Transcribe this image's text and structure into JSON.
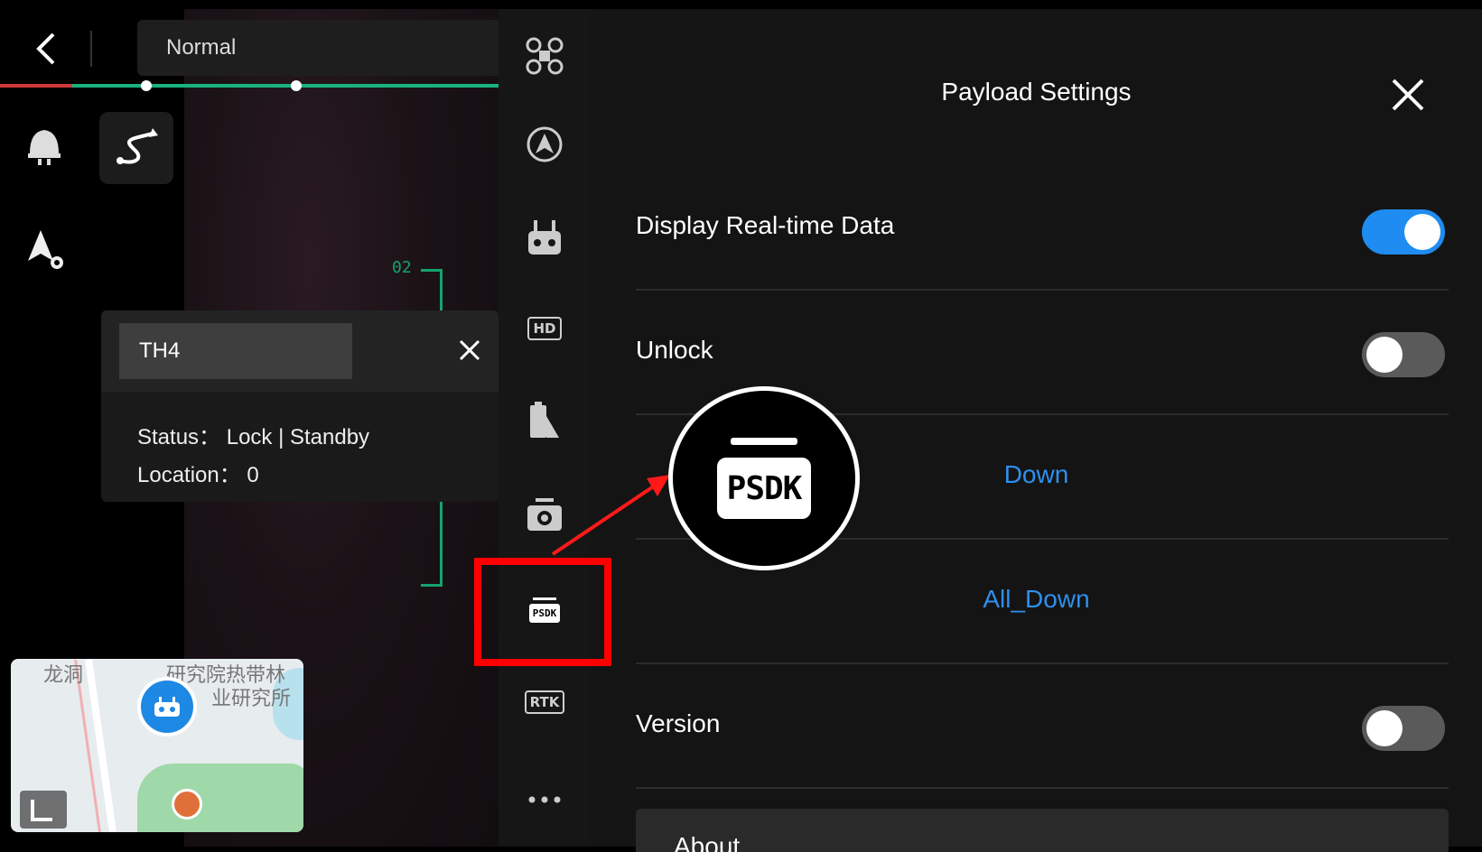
{
  "header": {
    "mode_label": "Normal"
  },
  "popup": {
    "device": "TH4",
    "status_label": "Status",
    "status_value": "Lock | Standby",
    "location_label": "Location",
    "location_value": "0",
    "bracket_label": "02"
  },
  "map": {
    "label_1": "龙洞",
    "label_2": "研究院热带林",
    "label_3": "业研究所"
  },
  "toolbar": {
    "hd_label": "HD",
    "psdk_label": "PSDK",
    "rtk_label": "RTK"
  },
  "panel": {
    "title": "Payload Settings",
    "rows": {
      "realtime_label": "Display Real-time Data",
      "realtime_on": true,
      "unlock_label": "Unlock",
      "unlock_on": false,
      "down_label": "Down",
      "all_down_label": "All_Down",
      "version_label": "Version",
      "version_on": false,
      "about_label": "About"
    }
  },
  "callout": {
    "label": "PSDK"
  },
  "colors": {
    "accent": "#1e8cf0",
    "link": "#2e90ef",
    "highlight": "#ff0000",
    "hud_green": "#15a36d"
  }
}
